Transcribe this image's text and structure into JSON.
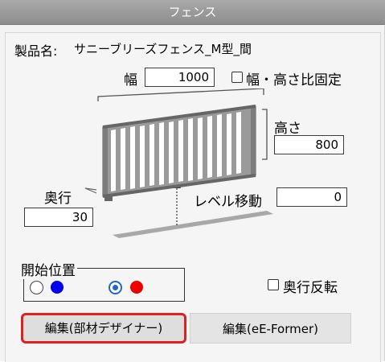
{
  "window": {
    "title": "フェンス"
  },
  "product": {
    "label": "製品名:",
    "name": "サニーブリーズフェンス_M型_間"
  },
  "width": {
    "label": "幅",
    "value": "1000"
  },
  "ratio_lock": {
    "label": "幅・高さ比固定",
    "checked": false
  },
  "height": {
    "label": "高さ",
    "value": "800"
  },
  "depth": {
    "label": "奥行",
    "value": "30"
  },
  "level": {
    "label": "レベル移動",
    "value": "0"
  },
  "start_position": {
    "label": "開始位置",
    "options": [
      {
        "selected": false,
        "color": "#0000ee"
      },
      {
        "selected": true,
        "color": "#ee0000"
      }
    ]
  },
  "depth_flip": {
    "label": "奥行反転",
    "checked": false
  },
  "buttons": {
    "edit_designer": "編集(部材デザイナー)",
    "edit_eformer": "編集(eE-Former)"
  },
  "highlight_color": "#e02020"
}
